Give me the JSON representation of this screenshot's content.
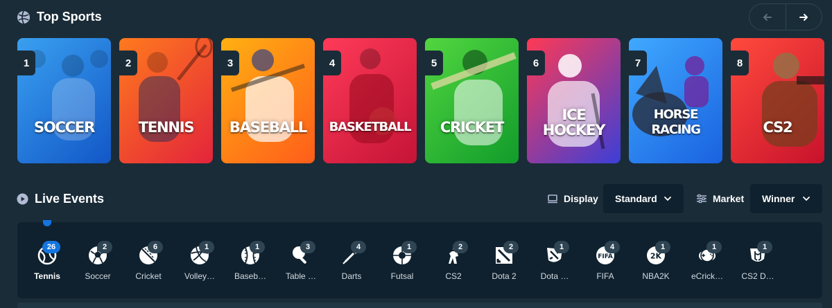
{
  "top_sports": {
    "title": "Top Sports",
    "nav": {
      "prev_icon": "arrow-left-icon",
      "next_icon": "arrow-right-icon"
    },
    "cards": [
      {
        "rank": "1",
        "name_lines": [
          "SOCCER"
        ],
        "colors": [
          "#3aa0f0",
          "#1257c7"
        ]
      },
      {
        "rank": "2",
        "name_lines": [
          "TENNIS"
        ],
        "colors": [
          "#ff7a1e",
          "#e3243b"
        ]
      },
      {
        "rank": "3",
        "name_lines": [
          "BASEBALL"
        ],
        "colors": [
          "#ffb012",
          "#ff5d1a"
        ]
      },
      {
        "rank": "4",
        "name_lines": [
          "BASKETBALL"
        ],
        "colors": [
          "#ff3a58",
          "#c51437"
        ]
      },
      {
        "rank": "5",
        "name_lines": [
          "CRICKET"
        ],
        "colors": [
          "#52d640",
          "#119c2b"
        ]
      },
      {
        "rank": "6",
        "name_lines": [
          "ICE",
          "HOCKEY"
        ],
        "colors": [
          "#ff3954",
          "#3b3fd8"
        ]
      },
      {
        "rank": "7",
        "name_lines": [
          "HORSE",
          "RACING"
        ],
        "colors": [
          "#3fa9ff",
          "#1a62e0"
        ]
      },
      {
        "rank": "8",
        "name_lines": [
          "CS2"
        ],
        "colors": [
          "#ff4a3d",
          "#c8122c"
        ]
      }
    ]
  },
  "live_events": {
    "title": "Live Events",
    "display": {
      "label": "Display",
      "value": "Standard"
    },
    "market": {
      "label": "Market",
      "value": "Winner"
    },
    "sports": [
      {
        "label": "Tennis",
        "count": "26",
        "icon": "tennis-ball-icon",
        "active": true
      },
      {
        "label": "Soccer",
        "count": "2",
        "icon": "soccer-ball-icon"
      },
      {
        "label": "Cricket",
        "count": "6",
        "icon": "cricket-ball-icon"
      },
      {
        "label": "Volley…",
        "count": "1",
        "icon": "volleyball-icon"
      },
      {
        "label": "Baseb…",
        "count": "1",
        "icon": "baseball-icon"
      },
      {
        "label": "Table …",
        "count": "3",
        "icon": "table-tennis-icon"
      },
      {
        "label": "Darts",
        "count": "4",
        "icon": "darts-icon"
      },
      {
        "label": "Futsal",
        "count": "1",
        "icon": "futsal-icon"
      },
      {
        "label": "CS2",
        "count": "2",
        "icon": "cs2-icon"
      },
      {
        "label": "Dota 2",
        "count": "2",
        "icon": "dota2-icon"
      },
      {
        "label": "Dota …",
        "count": "1",
        "icon": "dota-shield-icon"
      },
      {
        "label": "FIFA",
        "count": "4",
        "icon": "fifa-icon"
      },
      {
        "label": "NBA2K",
        "count": "1",
        "icon": "nba2k-icon"
      },
      {
        "label": "eCrick…",
        "count": "1",
        "icon": "ecricket-icon"
      },
      {
        "label": "CS2 D…",
        "count": "1",
        "icon": "cs2-duels-icon"
      }
    ]
  }
}
